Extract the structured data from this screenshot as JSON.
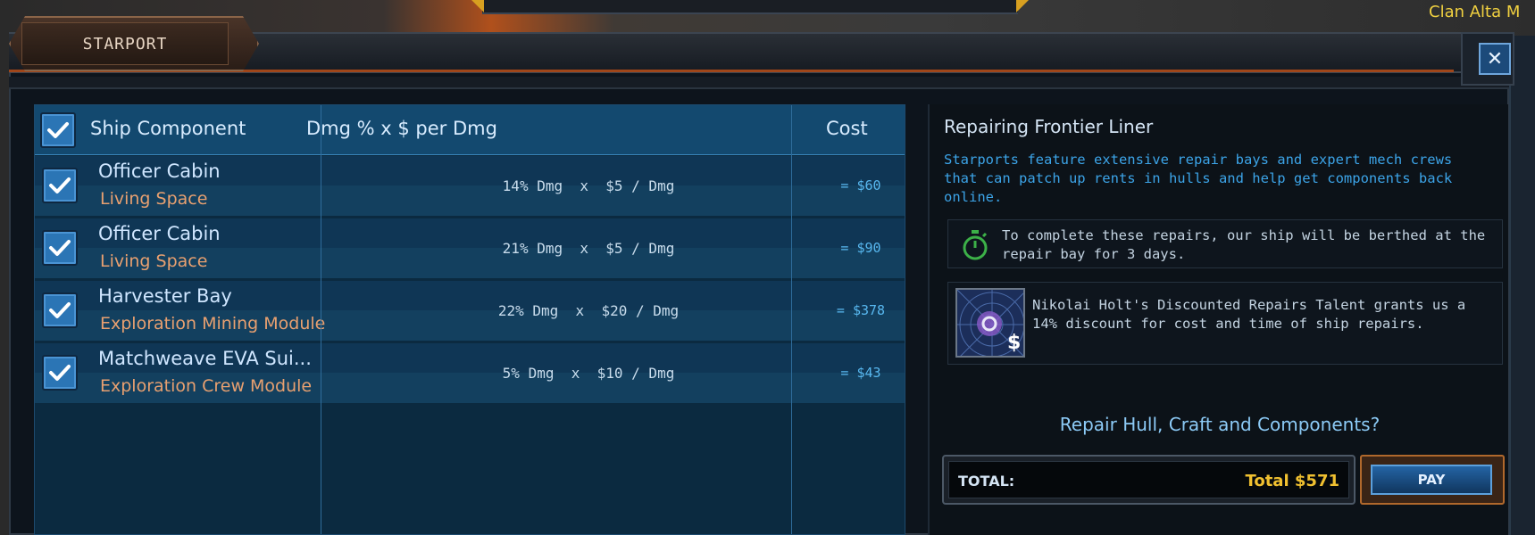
{
  "window": {
    "title": "STARPORT",
    "close_icon": "close-icon",
    "background_label": "Clan Alta M"
  },
  "components_table": {
    "header": {
      "component": "Ship Component",
      "damage": "Dmg % x $ per Dmg",
      "cost": "Cost"
    },
    "select_all_checked": true,
    "rows": [
      {
        "name": "Officer Cabin",
        "category": "Living Space",
        "damage": "14% Dmg  x  $5 / Dmg",
        "cost": "= $60",
        "checked": true
      },
      {
        "name": "Officer Cabin",
        "category": "Living Space",
        "damage": "21% Dmg  x  $5 / Dmg",
        "cost": "= $90",
        "checked": true
      },
      {
        "name": "Harvester Bay",
        "category": "Exploration Mining Module",
        "damage": "22% Dmg  x  $20 / Dmg",
        "cost": "= $378",
        "checked": true
      },
      {
        "name": "Matchweave EVA Sui...",
        "category": "Exploration Crew Module",
        "damage": "5% Dmg  x  $10 / Dmg",
        "cost": "= $43",
        "checked": true
      }
    ]
  },
  "repair_info": {
    "title": "Repairing Frontier Liner",
    "description": "Starports feature extensive repair bays and expert mech crews that can patch up rents in hulls and help get components back online.",
    "berth_notice": "To complete these repairs, our ship will be berthed at the repair bay for 3 days.",
    "talent_notice": "Nikolai Holt's Discounted Repairs Talent grants us a 14% discount for cost and time of ship repairs.",
    "question": "Repair Hull, Craft and Components?",
    "total_label": "TOTAL:",
    "total_value": "Total $571",
    "pay_label": "PAY"
  },
  "colors": {
    "accent_blue": "#2b75b5",
    "cost_blue": "#58b8f0",
    "category_orange": "#e8a070",
    "total_gold": "#f0c030"
  }
}
